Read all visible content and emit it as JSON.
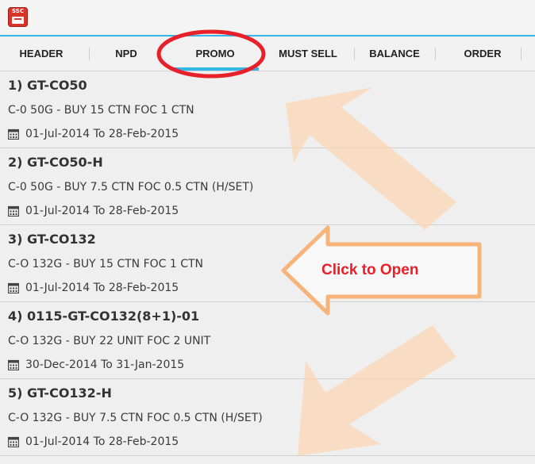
{
  "app": {
    "icon_text": "SSC"
  },
  "tabs": [
    {
      "label": "HEADER",
      "active": false
    },
    {
      "label": "NPD",
      "active": false
    },
    {
      "label": "PROMO",
      "active": true
    },
    {
      "label": "MUST SELL",
      "active": false
    },
    {
      "label": "BALANCE",
      "active": false
    },
    {
      "label": "ORDER",
      "active": false
    }
  ],
  "promos": [
    {
      "title": "1) GT-CO50",
      "desc": "C-0 50G - BUY 15 CTN FOC 1 CTN",
      "date": "01-Jul-2014  To  28-Feb-2015"
    },
    {
      "title": "2) GT-CO50-H",
      "desc": "C-0 50G - BUY 7.5 CTN FOC 0.5 CTN (H/SET)",
      "date": "01-Jul-2014  To  28-Feb-2015"
    },
    {
      "title": "3) GT-CO132",
      "desc": "C-O 132G - BUY 15 CTN FOC 1 CTN",
      "date": "01-Jul-2014  To  28-Feb-2015"
    },
    {
      "title": "4) 0115-GT-CO132(8+1)-01",
      "desc": "C-O 132G - BUY 22 UNIT FOC 2 UNIT",
      "date": "30-Dec-2014  To  31-Jan-2015"
    },
    {
      "title": "5) GT-CO132-H",
      "desc": "C-O 132G - BUY 7.5 CTN FOC 0.5 CTN (H/SET)",
      "date": "01-Jul-2014  To  28-Feb-2015"
    }
  ],
  "annotation": {
    "callout_text": "Click to Open",
    "highlight_color": "#e8202a",
    "arrow_color": "#fbd7b6",
    "callout_arrow_color": "#f7b47a"
  },
  "colors": {
    "accent": "#33b5e5"
  }
}
